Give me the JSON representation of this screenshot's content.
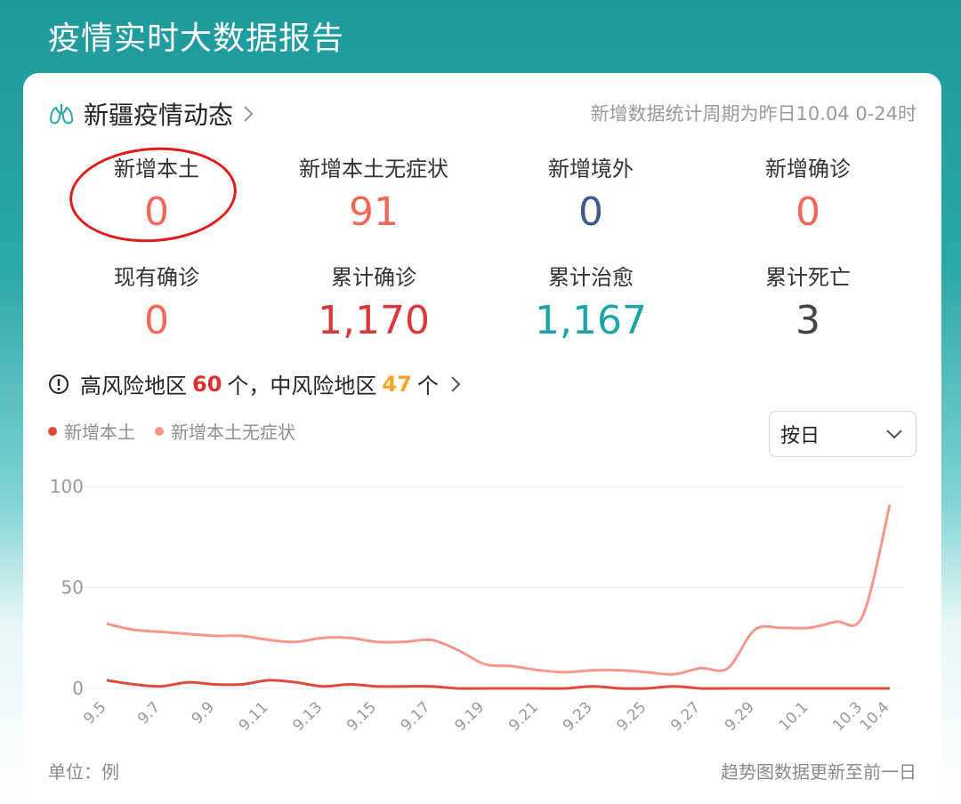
{
  "page_title": "疫情实时大数据报告",
  "header": {
    "region_title": "新疆疫情动态",
    "period_note": "新增数据统计周期为昨日10.04 0-24时"
  },
  "stats": [
    {
      "label": "新增本土",
      "value": "0",
      "color": "#f4685c"
    },
    {
      "label": "新增本土无症状",
      "value": "91",
      "color": "#f4685c"
    },
    {
      "label": "新增境外",
      "value": "0",
      "color": "#3f5a8a"
    },
    {
      "label": "新增确诊",
      "value": "0",
      "color": "#f4685c"
    },
    {
      "label": "现有确诊",
      "value": "0",
      "color": "#f4685c"
    },
    {
      "label": "累计确诊",
      "value": "1,170",
      "color": "#d9393a"
    },
    {
      "label": "累计治愈",
      "value": "1,167",
      "color": "#1aa6a6"
    },
    {
      "label": "累计死亡",
      "value": "3",
      "color": "#444444"
    }
  ],
  "risk": {
    "high_label": "高风险地区",
    "high_count": "60",
    "unit1": "个，",
    "mid_label": "中风险地区",
    "mid_count": "47",
    "unit2": "个",
    "high_color": "#e02f2f",
    "mid_color": "#f5a623"
  },
  "filter": {
    "selected": "按日"
  },
  "footer": {
    "unit": "单位：例",
    "update_note": "趋势图数据更新至前一日"
  },
  "chart_data": {
    "type": "line",
    "x": [
      "9.5",
      "9.6",
      "9.7",
      "9.8",
      "9.9",
      "9.10",
      "9.11",
      "9.12",
      "9.13",
      "9.14",
      "9.15",
      "9.16",
      "9.17",
      "9.18",
      "9.19",
      "9.20",
      "9.21",
      "9.22",
      "9.23",
      "9.24",
      "9.25",
      "9.26",
      "9.27",
      "9.28",
      "9.29",
      "9.30",
      "10.1",
      "10.2",
      "10.3",
      "10.4"
    ],
    "x_tick_labels": [
      "9.5",
      "9.7",
      "9.9",
      "9.11",
      "9.13",
      "9.15",
      "9.17",
      "9.19",
      "9.21",
      "9.23",
      "9.25",
      "9.27",
      "9.29",
      "10.1",
      "10.3",
      "10.4"
    ],
    "series": [
      {
        "name": "新增本土",
        "color": "#e04a3a",
        "values": [
          4,
          2,
          1,
          3,
          2,
          2,
          4,
          3,
          1,
          2,
          1,
          1,
          1,
          0,
          0,
          0,
          0,
          0,
          1,
          0,
          0,
          1,
          0,
          0,
          0,
          0,
          0,
          0,
          0,
          0
        ]
      },
      {
        "name": "新增本土无症状",
        "color": "#f7968c",
        "values": [
          32,
          29,
          28,
          27,
          26,
          26,
          24,
          23,
          25,
          25,
          23,
          23,
          24,
          19,
          12,
          11,
          9,
          8,
          9,
          9,
          8,
          7,
          10,
          10,
          29,
          30,
          30,
          33,
          36,
          91
        ]
      }
    ],
    "ylim": [
      0,
      100
    ],
    "yticks": [
      0,
      50,
      100
    ],
    "grid": true,
    "legend": "top-left"
  }
}
